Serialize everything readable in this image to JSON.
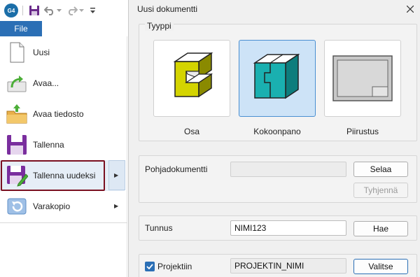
{
  "quick_access": {
    "logo_text": "G4",
    "icons": [
      "save-icon",
      "undo-icon",
      "dropdown-icon",
      "redo-icon",
      "dropdown-icon",
      "customize-icon"
    ]
  },
  "file_tab": {
    "label": "File"
  },
  "file_menu": {
    "items": [
      {
        "label": "Uusi",
        "icon": "new-document-icon"
      },
      {
        "label": "Avaa...",
        "icon": "open-icon"
      },
      {
        "label": "Avaa tiedosto",
        "icon": "open-file-icon"
      },
      {
        "label": "Tallenna",
        "icon": "save-icon"
      },
      {
        "label": "Tallenna uudeksi",
        "icon": "save-as-icon",
        "has_submenu": true
      },
      {
        "label": "Varakopio",
        "icon": "backup-icon",
        "has_submenu": true
      }
    ]
  },
  "dialog": {
    "title": "Uusi dokumentti",
    "type_group": {
      "label": "Tyyppi",
      "options": [
        {
          "label": "Osa",
          "selected": false
        },
        {
          "label": "Kokoonpano",
          "selected": true
        },
        {
          "label": "Piirustus",
          "selected": false
        }
      ]
    },
    "template": {
      "label": "Pohjadokumentti",
      "value": "",
      "browse_button": "Selaa",
      "clear_button": "Tyhjennä"
    },
    "id": {
      "label": "Tunnus",
      "value": "NIMI123",
      "fetch_button": "Hae"
    },
    "project": {
      "checkbox_label": "Projektiin",
      "checked": true,
      "value": "PROJEKTIN_NIMI",
      "select_button": "Valitse"
    }
  },
  "colors": {
    "accent": "#2b6fb5",
    "highlight_border": "#7a1020",
    "selected_card": "#cde3f7",
    "part_color": "#d4d400",
    "assembly_color": "#1ab0b0"
  }
}
